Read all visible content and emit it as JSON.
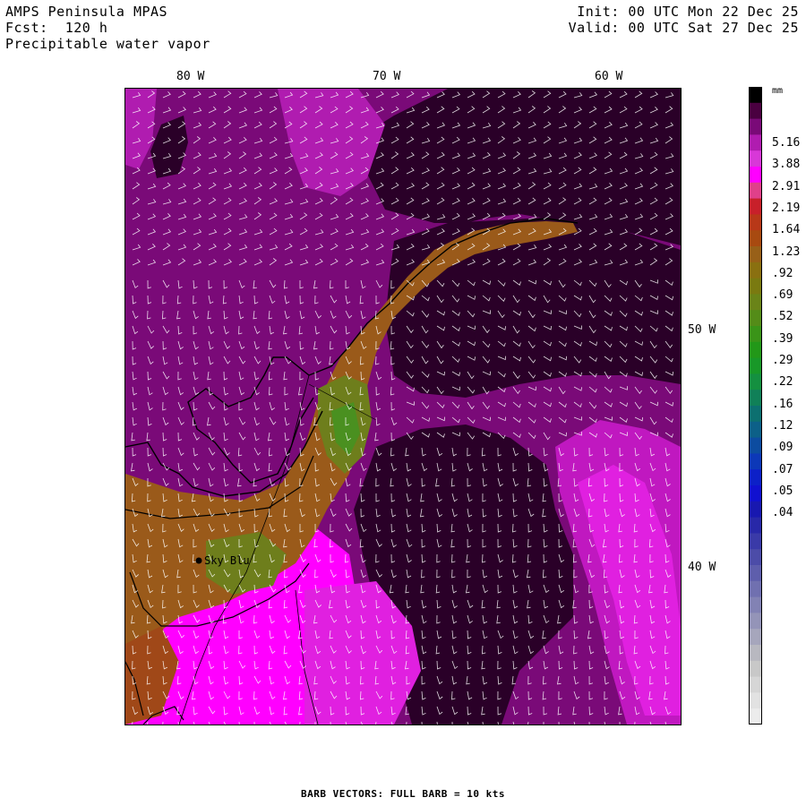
{
  "header": {
    "model": "AMPS Peninsula MPAS",
    "forecast": "Fcst:  120 h",
    "field": "Precipitable water vapor",
    "init": "Init: 00 UTC Mon 22 Dec 25",
    "valid": "Valid: 00 UTC Sat 27 Dec 25"
  },
  "axes": {
    "longitudes": [
      "80 W",
      "70 W",
      "60 W"
    ],
    "latitudes": [
      "50 W",
      "40 W"
    ]
  },
  "station": {
    "name": "Sky Blu"
  },
  "legend": {
    "unit": "mm",
    "labels": [
      "5.16",
      "3.88",
      "2.91",
      "2.19",
      "1.64",
      "1.23",
      ".92",
      ".69",
      ".52",
      ".39",
      ".29",
      ".22",
      ".16",
      ".12",
      ".09",
      ".07",
      ".05",
      ".04"
    ],
    "colors_top_to_bottom": [
      "#000000",
      "#4a0040",
      "#7a0a78",
      "#b01cb0",
      "#d838d8",
      "#ff00ff",
      "#e0408a",
      "#c8202a",
      "#b83818",
      "#a84a10",
      "#986018",
      "#8a7010",
      "#7a7a10",
      "#6a8418",
      "#548c18",
      "#3a9418",
      "#229818",
      "#189828",
      "#149040",
      "#108058",
      "#0c7070",
      "#0c6088",
      "#0c4ca0",
      "#0c38b8",
      "#0c20c8",
      "#1010d0",
      "#1818b0",
      "#2828a8",
      "#3a3aa8",
      "#4c4ca8",
      "#5e5eac",
      "#7070b0",
      "#8282b4",
      "#9494b8",
      "#a6a6bc",
      "#b8b8c0",
      "#c8c8c8",
      "#d6d6d6",
      "#e2e2e2",
      "#ececec"
    ]
  },
  "footer": {
    "text": "BARB VECTORS:  FULL BARB = 10 kts"
  },
  "colors": {
    "dry": "#2a0028",
    "low": "#7a0a78",
    "mid": "#b01cb0",
    "high": "#ff00ff",
    "moist_brown": "#9a5a1a",
    "moist_green": "#5e8a1e"
  }
}
